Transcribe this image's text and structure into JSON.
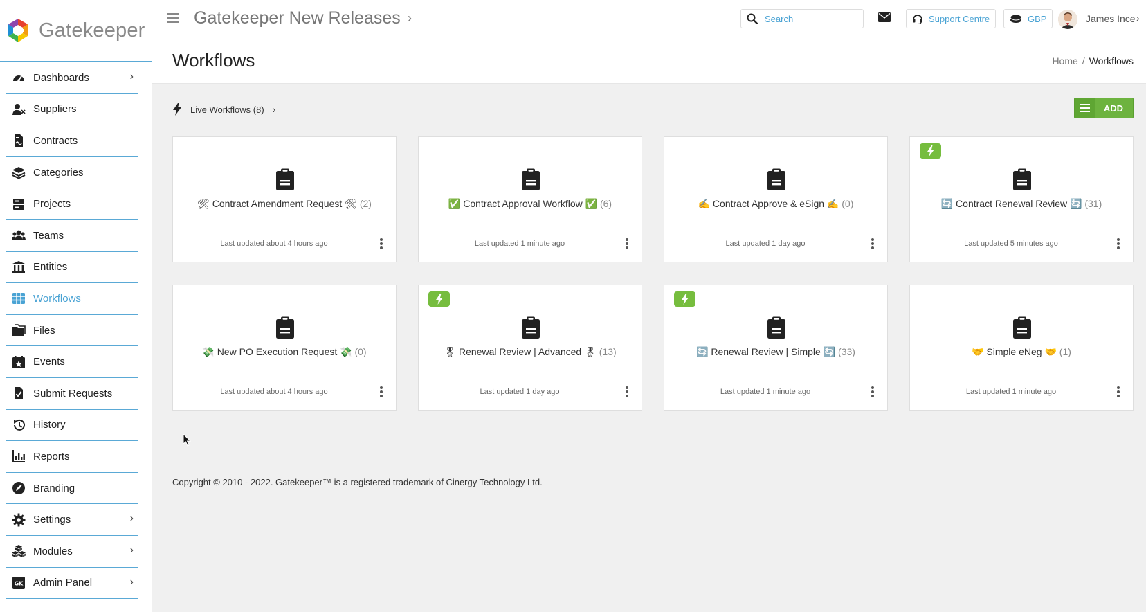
{
  "app": {
    "logo_text": "Gatekeeper",
    "title": "Gatekeeper New Releases"
  },
  "sidebar": {
    "items": [
      {
        "label": "Dashboards",
        "icon": "dashboard-icon",
        "chevron": true
      },
      {
        "label": "Suppliers",
        "icon": "supplier-icon",
        "chevron": false
      },
      {
        "label": "Contracts",
        "icon": "contract-icon",
        "chevron": false
      },
      {
        "label": "Categories",
        "icon": "layers-icon",
        "chevron": false
      },
      {
        "label": "Projects",
        "icon": "projects-icon",
        "chevron": false
      },
      {
        "label": "Teams",
        "icon": "teams-icon",
        "chevron": false
      },
      {
        "label": "Entities",
        "icon": "entities-icon",
        "chevron": false
      },
      {
        "label": "Workflows",
        "icon": "workflows-icon",
        "chevron": false,
        "active": true
      },
      {
        "label": "Files",
        "icon": "files-icon",
        "chevron": false
      },
      {
        "label": "Events",
        "icon": "events-icon",
        "chevron": false
      },
      {
        "label": "Submit Requests",
        "icon": "submit-requests-icon",
        "chevron": false
      },
      {
        "label": "History",
        "icon": "history-icon",
        "chevron": false
      },
      {
        "label": "Reports",
        "icon": "reports-icon",
        "chevron": false
      },
      {
        "label": "Branding",
        "icon": "branding-icon",
        "chevron": false
      },
      {
        "label": "Settings",
        "icon": "settings-icon",
        "chevron": true
      },
      {
        "label": "Modules",
        "icon": "modules-icon",
        "chevron": true
      },
      {
        "label": "Admin Panel",
        "icon": "admin-panel-icon",
        "chevron": true
      }
    ]
  },
  "topbar": {
    "search_placeholder": "Search",
    "support_label": "Support Centre",
    "currency_label": "GBP",
    "user_name": "James Ince"
  },
  "page": {
    "title": "Workflows",
    "breadcrumb": {
      "home": "Home",
      "separator": "/",
      "current": "Workflows"
    }
  },
  "live_workflows": {
    "label": "Live Workflows (8)"
  },
  "add_button": {
    "label": "ADD"
  },
  "accent_color": "#4aa3d4",
  "live_color": "#76bd3e",
  "cards": [
    {
      "title": "🛠 Contract Amendment Request 🛠",
      "count": "(2)",
      "updated": "Last updated about 4 hours ago",
      "live": false
    },
    {
      "title": "✅ Contract Approval Workflow ✅",
      "count": "(6)",
      "updated": "Last updated 1 minute ago",
      "live": false
    },
    {
      "title": "✍️ Contract Approve & eSign ✍️",
      "count": "(0)",
      "updated": "Last updated 1 day ago",
      "live": false
    },
    {
      "title": "🔄 Contract Renewal Review 🔄",
      "count": "(31)",
      "updated": "Last updated 5 minutes ago",
      "live": true
    },
    {
      "title": "💸 New PO Execution Request 💸",
      "count": "(0)",
      "updated": "Last updated about 4 hours ago",
      "live": false
    },
    {
      "title": "🎖 Renewal Review | Advanced 🎖",
      "count": "(13)",
      "updated": "Last updated 1 day ago",
      "live": true
    },
    {
      "title": "🔄 Renewal Review | Simple 🔄",
      "count": "(33)",
      "updated": "Last updated 1 minute ago",
      "live": true
    },
    {
      "title": "🤝 Simple eNeg 🤝",
      "count": "(1)",
      "updated": "Last updated 1 minute ago",
      "live": false
    }
  ],
  "footer": {
    "copyright": "Copyright © 2010 - 2022. Gatekeeper™ is a registered trademark of Cinergy Technology Ltd."
  }
}
